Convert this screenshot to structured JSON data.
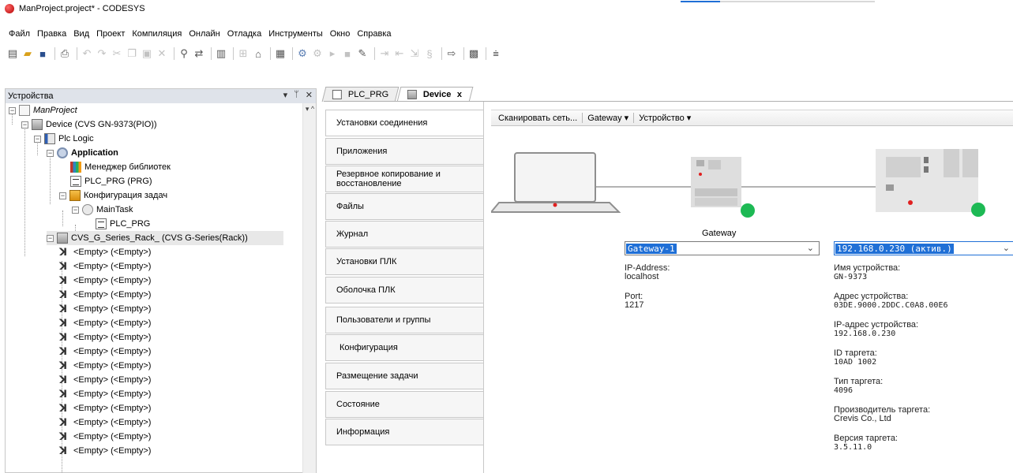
{
  "window": {
    "title": "ManProject.project* - CODESYS"
  },
  "menu": [
    "Файл",
    "Правка",
    "Вид",
    "Проект",
    "Компиляция",
    "Онлайн",
    "Отладка",
    "Инструменты",
    "Окно",
    "Справка"
  ],
  "devices_panel": {
    "title": "Устройства",
    "header_buttons": {
      "dropdown": "▾",
      "pin": "ᛘ",
      "close": "✕"
    },
    "tree": [
      {
        "label": "ManProject",
        "style": "italic"
      },
      {
        "label": "Device (CVS GN-9373(PIO))"
      },
      {
        "label": "Plc Logic"
      },
      {
        "label": "Application",
        "style": "bold"
      },
      {
        "label": "Менеджер библиотек"
      },
      {
        "label": "PLC_PRG (PRG)"
      },
      {
        "label": "Конфигурация задач"
      },
      {
        "label": "MainTask"
      },
      {
        "label": "PLC_PRG"
      },
      {
        "label": "CVS_G_Series_Rack_ (CVS G-Series(Rack))"
      }
    ],
    "empty_slot_label": "<Empty> (<Empty>)",
    "empty_slots": [
      "<Empty> (<Empty>)",
      "<Empty> (<Empty>)",
      "<Empty> (<Empty>)",
      "<Empty> (<Empty>)",
      "<Empty> (<Empty>)",
      "<Empty> (<Empty>)",
      "<Empty> (<Empty>)",
      "<Empty> (<Empty>)",
      "<Empty> (<Empty>)",
      "<Empty> (<Empty>)",
      "<Empty> (<Empty>)",
      "<Empty> (<Empty>)",
      "<Empty> (<Empty>)",
      "<Empty> (<Empty>)",
      "<Empty> (<Empty>)"
    ]
  },
  "editor_tabs": [
    {
      "label": "PLC_PRG",
      "close": ""
    },
    {
      "label": "Device",
      "close": "x"
    }
  ],
  "device_sidetabs": [
    "Установки соединения",
    "Приложения",
    "Резервное копирование и восстановление",
    "Файлы",
    "Журнал",
    "Установки ПЛК",
    "Оболочка ПЛК",
    "Пользователи и группы",
    "Конфигурация",
    "Размещение задачи",
    "Состояние",
    "Информация"
  ],
  "connection_toolbar": {
    "scan": "Сканировать сеть...",
    "gateway": "Gateway ▾",
    "device": "Устройство ▾"
  },
  "diagram": {
    "gateway_label": "Gateway",
    "status_color": "#1db954"
  },
  "gateway": {
    "selected": "Gateway-1",
    "ip_label": "IP-Address:",
    "ip_value": "localhost",
    "port_label": "Port:",
    "port_value": "1217"
  },
  "device": {
    "selected": "192.168.0.230 (актив.)",
    "fields": [
      {
        "label": "Имя устройства:",
        "value": "GN-9373"
      },
      {
        "label": "Адрес устройства:",
        "value": "03DE.9000.2DDC.C0A8.00E6"
      },
      {
        "label": "IP-адрес устройства:",
        "value": "192.168.0.230"
      },
      {
        "label": "ID таргета:",
        "value": "10AD 1002"
      },
      {
        "label": "Тип таргета:",
        "value": "4096"
      },
      {
        "label": "Производитель таргета:",
        "value": "Crevis Co., Ltd"
      },
      {
        "label": "Версия таргета:",
        "value": "3.5.11.0"
      }
    ]
  }
}
